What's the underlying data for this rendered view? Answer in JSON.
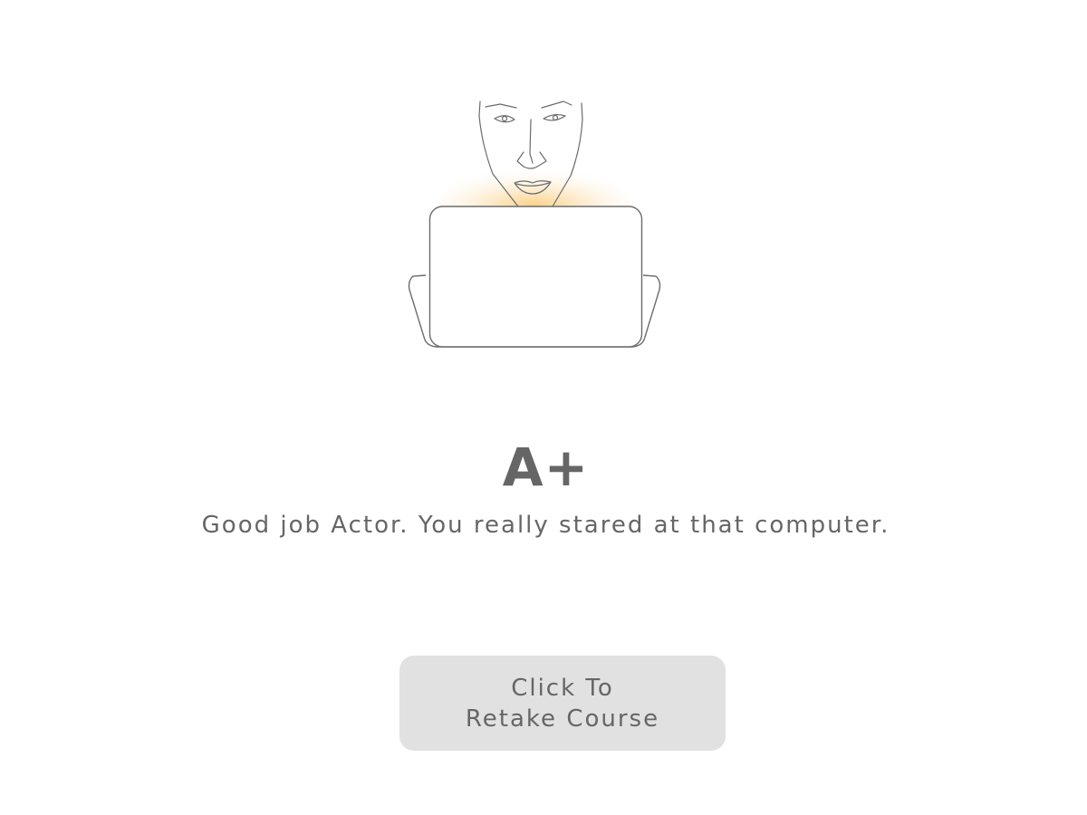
{
  "result": {
    "grade": "A+",
    "message": "Good job Actor. You really stared at that computer."
  },
  "retake_button": {
    "line1": "Click To",
    "line2": "Retake Course"
  },
  "illustration": {
    "icon": "person-at-laptop-icon",
    "glow_color": "#fbd48a",
    "stroke_color": "#6b6b6b"
  }
}
